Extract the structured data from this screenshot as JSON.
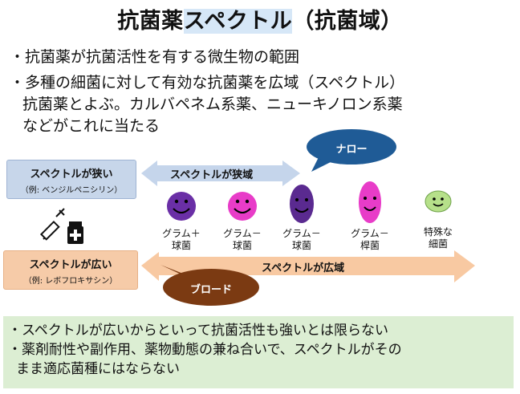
{
  "title": {
    "before": "抗菌薬",
    "highlight": "スペクトル",
    "after": "（抗菌域）"
  },
  "bullets": [
    "・抗菌薬が抗菌活性を有する微生物の範囲",
    "・多種の細菌に対して有効な抗菌薬を広域（スペクトル）",
    "抗菌薬とよぶ。カルバペネム系薬、ニューキノロン系薬",
    "などがこれに当たる"
  ],
  "narrow": {
    "label": "スペクトルが狭い",
    "example": "（例: ベンジルペニシリン）",
    "arrow_label": "スペクトルが狭域",
    "bubble": "ナロー"
  },
  "broad": {
    "label": "スペクトルが広い",
    "example": "（例: レボフロキサシン）",
    "arrow_label": "スペクトルが広域",
    "bubble": "ブロード"
  },
  "bacteria": [
    {
      "line1": "グラム＋",
      "line2": "球菌",
      "color": "#6a2fa6"
    },
    {
      "line1": "グラム－",
      "line2": "球菌",
      "color": "#e83cc8"
    },
    {
      "line1": "グラム－",
      "line2": "球菌",
      "color": "#5a2a90"
    },
    {
      "line1": "グラム－",
      "line2": "桿菌",
      "color": "#e83cc8"
    },
    {
      "line1": "特殊な",
      "line2": "細菌",
      "color": "#b6e08a"
    }
  ],
  "icons": {
    "medicine": "syringe-and-bottle-icon"
  },
  "notes": [
    "・スペクトルが広いからといって抗菌活性も強いとは限らない",
    "・薬剤耐性や副作用、薬物動態の兼ね合いで、スペクトルがその",
    "まま適応菌種にはならない"
  ],
  "colors": {
    "narrow_bg": "#c7d6ea",
    "narrow_arrow": "#c5d5eb",
    "broad_bg": "#f6cba8",
    "broad_arrow": "#f8c9a2",
    "narrow_bubble": "#1f5b96",
    "broad_bubble": "#7b3a12",
    "notes_bg": "#dceed3"
  }
}
